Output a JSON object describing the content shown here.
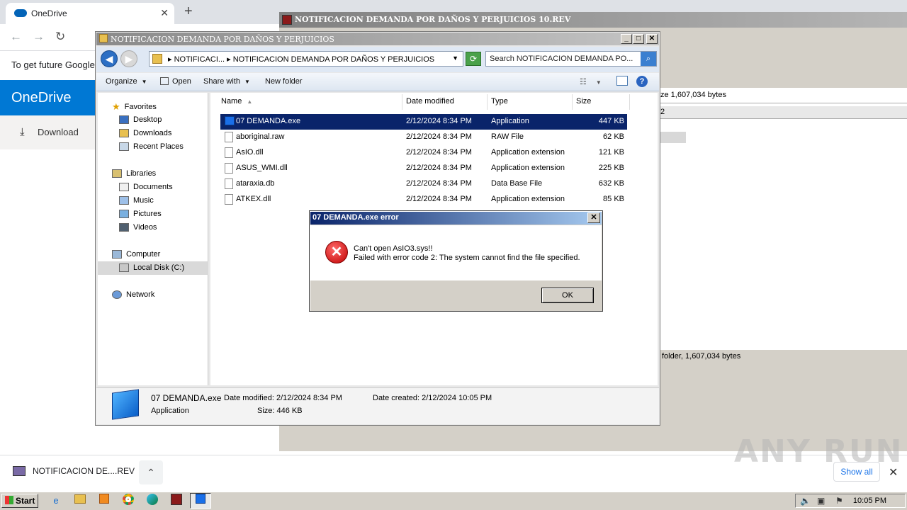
{
  "chrome": {
    "tab_title": "OneDrive",
    "tab_close": "✕",
    "new_tab": "+",
    "info_text": "To get future Google",
    "onedrive_brand": "OneDrive",
    "download_label": "Download",
    "download_bar": {
      "file_label": "NOTIFICACION DE....REV",
      "show_all": "Show all"
    }
  },
  "winrar": {
    "title": "NOTIFICACION DEMANDA POR DAÑOS Y PERJUICIOS 10.REV",
    "size_text": "ze 1,607,034 bytes",
    "header_cell": "2",
    "status_text": "folder, 1,607,034 bytes"
  },
  "explorer": {
    "title": "NOTIFICACION DEMANDA POR DAÑOS Y PERJUICIOS",
    "address_crumb1": "NOTIFICACI...",
    "address_crumb2": "NOTIFICACION DEMANDA POR DAÑOS Y PERJUICIOS",
    "search_placeholder": "Search NOTIFICACION DEMANDA PO...",
    "commands": {
      "organize": "Organize",
      "open": "Open",
      "share_with": "Share with",
      "new_folder": "New folder"
    },
    "nav": {
      "favorites": "Favorites",
      "desktop": "Desktop",
      "downloads": "Downloads",
      "recent_places": "Recent Places",
      "libraries": "Libraries",
      "documents": "Documents",
      "music": "Music",
      "pictures": "Pictures",
      "videos": "Videos",
      "computer": "Computer",
      "local_disk": "Local Disk (C:)",
      "network": "Network"
    },
    "columns": {
      "name": "Name",
      "date_modified": "Date modified",
      "type": "Type",
      "size": "Size"
    },
    "files": [
      {
        "name": "07 DEMANDA.exe",
        "date": "2/12/2024 8:34 PM",
        "type": "Application",
        "size": "447 KB"
      },
      {
        "name": "aboriginal.raw",
        "date": "2/12/2024 8:34 PM",
        "type": "RAW File",
        "size": "62 KB"
      },
      {
        "name": "AsIO.dll",
        "date": "2/12/2024 8:34 PM",
        "type": "Application extension",
        "size": "121 KB"
      },
      {
        "name": "ASUS_WMI.dll",
        "date": "2/12/2024 8:34 PM",
        "type": "Application extension",
        "size": "225 KB"
      },
      {
        "name": "ataraxia.db",
        "date": "2/12/2024 8:34 PM",
        "type": "Data Base File",
        "size": "632 KB"
      },
      {
        "name": "ATKEX.dll",
        "date": "2/12/2024 8:34 PM",
        "type": "Application extension",
        "size": "85 KB"
      }
    ],
    "details": {
      "name": "07 DEMANDA.exe",
      "kind": "Application",
      "date_modified": "Date modified: 2/12/2024 8:34 PM",
      "size": "Size: 446 KB",
      "date_created": "Date created: 2/12/2024 10:05 PM"
    }
  },
  "dialog": {
    "title": "07 DEMANDA.exe error",
    "line1": "Can't open AsIO3.sys!!",
    "line2": "Failed with error code 2: The system cannot find the file specified.",
    "ok": "OK"
  },
  "taskbar": {
    "start": "Start",
    "time": "10:05 PM"
  },
  "watermark": "ANY RUN"
}
